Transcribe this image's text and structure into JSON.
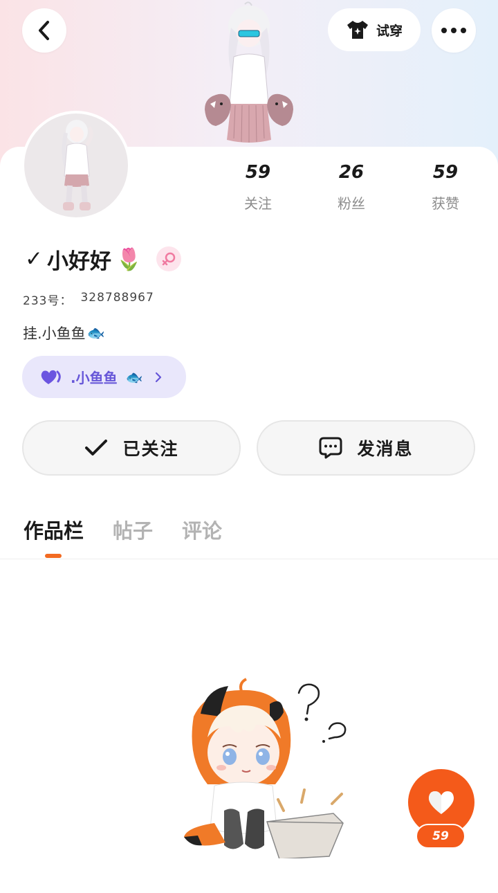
{
  "header": {
    "try_on_label": "试穿",
    "icons": [
      "back-icon",
      "shirt-icon",
      "more-icon"
    ]
  },
  "stats": [
    {
      "value": "59",
      "label": "关注"
    },
    {
      "value": "26",
      "label": "粉丝"
    },
    {
      "value": "59",
      "label": "获赞"
    }
  ],
  "profile": {
    "verified_mark": "✓",
    "name": "小好好",
    "name_emoji": "🌷",
    "gender": "female",
    "uid_label": "233号：",
    "uid": "328788967",
    "bio_text": "挂.小鱼鱼",
    "bio_emoji": "🐟",
    "guild_label": ".小鱼鱼",
    "guild_emoji": "🐟"
  },
  "actions": {
    "followed_label": "已关注",
    "message_label": "发消息"
  },
  "tabs": [
    {
      "label": "作品栏",
      "active": true
    },
    {
      "label": "帖子",
      "active": false
    },
    {
      "label": "评论",
      "active": false
    }
  ],
  "like_fab": {
    "count": "59"
  },
  "colors": {
    "accent": "#f45a1a",
    "guild_bg": "#e9e7fb",
    "guild_text": "#6656d8",
    "gender_bg": "#fde4ec",
    "gender_icon": "#f07aa0"
  }
}
